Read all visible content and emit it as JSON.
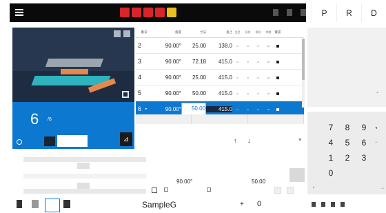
{
  "topbar": {
    "menu_icon": "hamburger-menu-icon",
    "alert_icons": [
      "alarm-icon",
      "alarm-icon",
      "alarm-icon",
      "alarm-icon",
      "warning-icon"
    ],
    "colors": {
      "bar": "#0a0a0a",
      "alert": "#d8252b",
      "warning": "#e8c020"
    }
  },
  "mode_buttons": [
    "P",
    "R",
    "D"
  ],
  "step": {
    "current": "6",
    "total": "/6",
    "accent": "#0d78cf"
  },
  "table": {
    "columns": [
      "番号",
      "角度",
      "寸法",
      "長さ",
      "金型",
      "形状",
      "保持",
      "挙動",
      "確認"
    ],
    "rows": [
      {
        "num": "2",
        "mark": "",
        "angle": "90.00°",
        "depth": "25.00",
        "length": "138.0",
        "t1": "••",
        "t2": "••",
        "t3": "••",
        "t4": "•••"
      },
      {
        "num": "3",
        "mark": "",
        "angle": "90.00°",
        "depth": "72.18",
        "length": "415.0",
        "t1": "••",
        "t2": "••",
        "t3": "••",
        "t4": "•••"
      },
      {
        "num": "4",
        "mark": "",
        "angle": "90.00°",
        "depth": "25.00",
        "length": "415.0",
        "t1": "••",
        "t2": "••",
        "t3": "••",
        "t4": "•••"
      },
      {
        "num": "5",
        "mark": "",
        "angle": "90.00°",
        "depth": "50.00",
        "length": "415.0",
        "t1": "••",
        "t2": "••",
        "t3": "••",
        "t4": "•••"
      },
      {
        "num": "6",
        "mark": "▸",
        "angle": "90.00°",
        "depth": "50.00",
        "length": "415.0",
        "t1": "••",
        "t2": "••",
        "t3": "••",
        "t4": "•••"
      }
    ]
  },
  "values": {
    "angle": "90.00°",
    "length": "50.00"
  },
  "keypad": {
    "keys": [
      "7",
      "8",
      "9",
      "4",
      "5",
      "6",
      "1",
      "2",
      "3",
      "0"
    ]
  },
  "bottombar": {
    "program_name": "SampleG",
    "plus": "+",
    "count": "0"
  }
}
